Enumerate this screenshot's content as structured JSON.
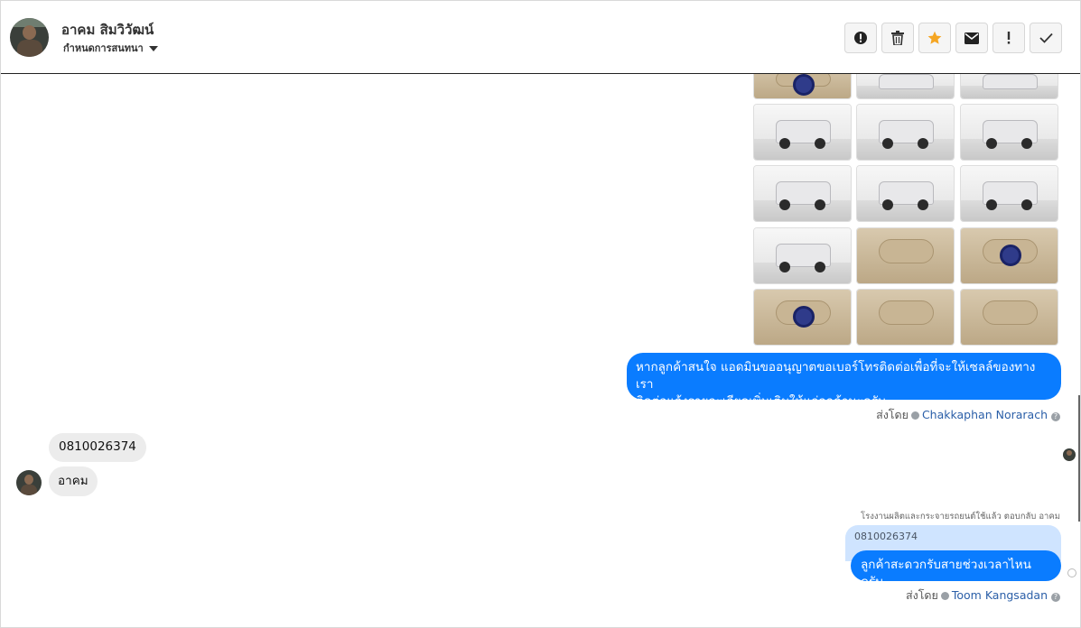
{
  "header": {
    "contact_name": "อาคม สิมวิวัฒน์",
    "assign_label": "กำหนดการสนทนา",
    "tool_icons": [
      "alert-circle-icon",
      "trash-icon",
      "star-icon",
      "envelope-icon",
      "exclamation-icon",
      "check-icon"
    ],
    "star_color": "#f5a623"
  },
  "conversation": {
    "admin_message": "หากลูกค้าสนใจ แอดมินขออนุญาตขอเบอร์โทรติดต่อเพื่อที่จะให้เซลล์ของทางเรา ติดต่อแจ้งรายละเอียดเพิ่มเติมให้แก่ลูกค้านะครับ",
    "admin_message_line1": "หากลูกค้าสนใจ แอดมินขออนุญาตขอเบอร์โทรติดต่อเพื่อที่จะให้เซลล์ของทางเรา",
    "admin_message_line2": "ติดต่อแจ้งรายละเอียดเพิ่มเติมให้แก่ลูกค้านะครับ",
    "sent_by_label": "ส่งโดย",
    "sent_by_1": "Chakkaphan Norarach",
    "customer_msg_1": "0810026374",
    "customer_msg_2": "อาคม",
    "reply_note": "โรงงานผลิตและกระจายรถยนต์ใช้แล้ว ตอบกลับ อาคม",
    "quoted_text": "0810026374",
    "reply_message": "ลูกค้าสะดวกรับสายช่วงเวลาไหนครับ",
    "sent_by_2": "Toom Kangsadan",
    "outgoing_color": "#0a7cff"
  }
}
